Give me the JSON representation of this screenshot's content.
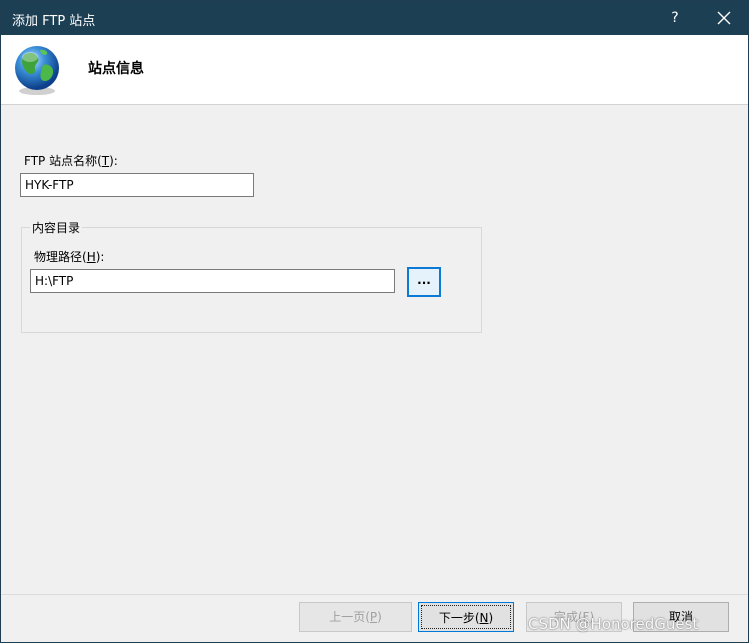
{
  "window": {
    "title": "添加 FTP 站点",
    "help_label": "?"
  },
  "header": {
    "title": "站点信息",
    "icon": "globe-icon"
  },
  "form": {
    "site_name_label_prefix": "FTP 站点名称(",
    "site_name_hotkey": "T",
    "site_name_label_suffix": "):",
    "site_name_value": "HYK-FTP",
    "content_group_title": "内容目录",
    "physical_path_label_prefix": "物理路径(",
    "physical_path_hotkey": "H",
    "physical_path_label_suffix": "):",
    "physical_path_value": "H:\\FTP",
    "browse_label": "..."
  },
  "footer": {
    "prev": {
      "prefix": "上一页(",
      "hotkey": "P",
      "suffix": ")"
    },
    "next": {
      "prefix": "下一步(",
      "hotkey": "N",
      "suffix": ")"
    },
    "finish": {
      "prefix": "完成(",
      "hotkey": "F",
      "suffix": ")"
    },
    "cancel_label": "取消"
  },
  "watermark": "CSDN @HonoredGuest",
  "colors": {
    "titlebar": "#1d3f54",
    "accent": "#0078d7",
    "background": "#f0f0f0"
  }
}
